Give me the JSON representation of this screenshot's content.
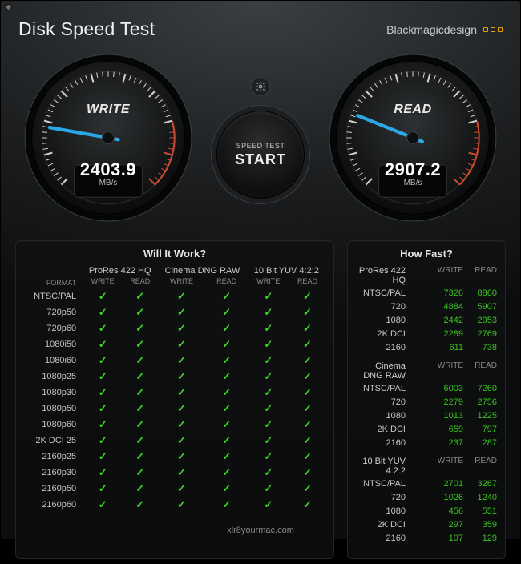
{
  "header": {
    "app_title": "Disk Speed Test",
    "brand": "Blackmagicdesign"
  },
  "gauges": {
    "write": {
      "label": "WRITE",
      "value": "2403.9",
      "unit": "MB/s",
      "angle": -170
    },
    "read": {
      "label": "READ",
      "value": "2907.2",
      "unit": "MB/s",
      "angle": -158
    }
  },
  "controls": {
    "speed_test_label_small": "SPEED TEST",
    "start_label": "START"
  },
  "wiw": {
    "title": "Will It Work?",
    "format_header": "FORMAT",
    "groups": [
      "ProRes 422 HQ",
      "Cinema DNG RAW",
      "10 Bit YUV 4:2:2"
    ],
    "sub": [
      "WRITE",
      "READ"
    ],
    "rows": [
      {
        "format": "NTSC/PAL",
        "cells": [
          true,
          true,
          true,
          true,
          true,
          true
        ]
      },
      {
        "format": "720p50",
        "cells": [
          true,
          true,
          true,
          true,
          true,
          true
        ]
      },
      {
        "format": "720p60",
        "cells": [
          true,
          true,
          true,
          true,
          true,
          true
        ]
      },
      {
        "format": "1080i50",
        "cells": [
          true,
          true,
          true,
          true,
          true,
          true
        ]
      },
      {
        "format": "1080i60",
        "cells": [
          true,
          true,
          true,
          true,
          true,
          true
        ]
      },
      {
        "format": "1080p25",
        "cells": [
          true,
          true,
          true,
          true,
          true,
          true
        ]
      },
      {
        "format": "1080p30",
        "cells": [
          true,
          true,
          true,
          true,
          true,
          true
        ]
      },
      {
        "format": "1080p50",
        "cells": [
          true,
          true,
          true,
          true,
          true,
          true
        ]
      },
      {
        "format": "1080p60",
        "cells": [
          true,
          true,
          true,
          true,
          true,
          true
        ]
      },
      {
        "format": "2K DCI 25",
        "cells": [
          true,
          true,
          true,
          true,
          true,
          true
        ]
      },
      {
        "format": "2160p25",
        "cells": [
          true,
          true,
          true,
          true,
          true,
          true
        ]
      },
      {
        "format": "2160p30",
        "cells": [
          true,
          true,
          true,
          true,
          true,
          true
        ]
      },
      {
        "format": "2160p50",
        "cells": [
          true,
          true,
          true,
          true,
          true,
          true
        ]
      },
      {
        "format": "2160p60",
        "cells": [
          true,
          true,
          true,
          true,
          true,
          true
        ]
      }
    ]
  },
  "hf": {
    "title": "How Fast?",
    "col_write": "WRITE",
    "col_read": "READ",
    "groups": [
      {
        "name": "ProRes 422 HQ",
        "rows": [
          {
            "name": "NTSC/PAL",
            "write": "7326",
            "read": "8860"
          },
          {
            "name": "720",
            "write": "4884",
            "read": "5907"
          },
          {
            "name": "1080",
            "write": "2442",
            "read": "2953"
          },
          {
            "name": "2K DCI",
            "write": "2289",
            "read": "2769"
          },
          {
            "name": "2160",
            "write": "611",
            "read": "738"
          }
        ]
      },
      {
        "name": "Cinema DNG RAW",
        "rows": [
          {
            "name": "NTSC/PAL",
            "write": "6003",
            "read": "7260"
          },
          {
            "name": "720",
            "write": "2279",
            "read": "2756"
          },
          {
            "name": "1080",
            "write": "1013",
            "read": "1225"
          },
          {
            "name": "2K DCI",
            "write": "659",
            "read": "797"
          },
          {
            "name": "2160",
            "write": "237",
            "read": "287"
          }
        ]
      },
      {
        "name": "10 Bit YUV 4:2:2",
        "rows": [
          {
            "name": "NTSC/PAL",
            "write": "2701",
            "read": "3267"
          },
          {
            "name": "720",
            "write": "1026",
            "read": "1240"
          },
          {
            "name": "1080",
            "write": "456",
            "read": "551"
          },
          {
            "name": "2K DCI",
            "write": "297",
            "read": "359"
          },
          {
            "name": "2160",
            "write": "107",
            "read": "129"
          }
        ]
      }
    ]
  },
  "watermark": "xlr8yourmac.com"
}
